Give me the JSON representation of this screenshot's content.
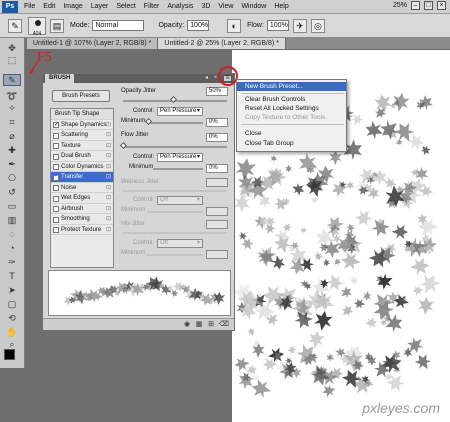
{
  "menubar": {
    "logo": "Ps",
    "items": [
      "File",
      "Edit",
      "Image",
      "Layer",
      "Select",
      "Filter",
      "Analysis",
      "3D",
      "View",
      "Window",
      "Help"
    ],
    "zoom": "25%"
  },
  "options": {
    "brush_size": "404",
    "mode_label": "Mode:",
    "mode_value": "Normal",
    "opacity_label": "Opacity:",
    "opacity_value": "100%",
    "flow_label": "Flow:",
    "flow_value": "100%"
  },
  "tabs": [
    {
      "label": "Untitled-1 @ 107% (Layer 2, RGB/8) *"
    },
    {
      "label": "Untitled-2 @ 25% (Layer 2, RGB/8) *"
    }
  ],
  "annotation": {
    "f5": "F5"
  },
  "brush_panel": {
    "tab_title": "BRUSH",
    "brush_presets_button": "Brush Presets",
    "options": [
      {
        "label": "Brush Tip Shape",
        "checked": false,
        "header": true
      },
      {
        "label": "Shape Dynamics",
        "checked": true
      },
      {
        "label": "Scattering",
        "checked": false
      },
      {
        "label": "Texture",
        "checked": false
      },
      {
        "label": "Dual Brush",
        "checked": false
      },
      {
        "label": "Color Dynamics",
        "checked": false
      },
      {
        "label": "Transfer",
        "checked": true,
        "selected": true
      },
      {
        "label": "Noise",
        "checked": false
      },
      {
        "label": "Wet Edges",
        "checked": false
      },
      {
        "label": "Airbrush",
        "checked": false
      },
      {
        "label": "Smoothing",
        "checked": false
      },
      {
        "label": "Protect Texture",
        "checked": false
      }
    ],
    "opacity_jitter_label": "Opacity Jitter",
    "opacity_jitter_value": "50%",
    "control_label": "Control:",
    "control_value": "Pen Pressure",
    "minimum_label": "Minimum",
    "minimum_value": "0%",
    "flow_jitter_label": "Flow Jitter",
    "flow_jitter_value": "0%",
    "control2_value": "Pen Pressure",
    "minimum2_value": "0%",
    "wetness_jitter_label": "Wetness Jitter",
    "control3_value": "Off",
    "minimum3_label": "Minimum",
    "mix_jitter_label": "Mix Jitter",
    "control4_value": "Off",
    "minimum4_label": "Minimum"
  },
  "flyout_menu": {
    "items": [
      {
        "label": "New Brush Preset...",
        "state": "highlighted"
      },
      {
        "label": "Clear Brush Controls",
        "state": "normal"
      },
      {
        "label": "Reset All Locked Settings",
        "state": "normal"
      },
      {
        "label": "Copy Texture to Other Tools",
        "state": "disabled"
      },
      {
        "label": "Close",
        "state": "normal"
      },
      {
        "label": "Close Tab Group",
        "state": "normal"
      }
    ]
  },
  "watermark": "pxleyes.com",
  "colors": {
    "accent_blue": "#3a6ac3",
    "annotation_red": "#d21f1f",
    "ps_logo_blue": "#1b5aa5"
  }
}
